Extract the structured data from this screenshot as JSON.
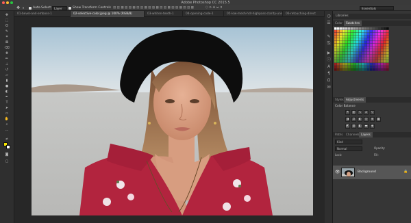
{
  "app": {
    "title": "Adobe Photoshop CC 2015.5",
    "workspace": "Essentials"
  },
  "options_bar": {
    "auto_select_label": "Auto-Select:",
    "auto_select_value": "Layer",
    "show_transform_label": "Show Transform Controls"
  },
  "tabs": [
    {
      "label": "01-bevel-and-emboss-1"
    },
    {
      "label": "02-selective-color.jpeg @ 100% (RGB/8)"
    },
    {
      "label": "03-whiten-teeth-1"
    },
    {
      "label": "04-opening-code-1"
    },
    {
      "label": "05-low-mesh-hdr-highpass-clarity-unsharp-1"
    },
    {
      "label": "06-retouching-direct"
    }
  ],
  "panels": {
    "libraries": {
      "title": "Libraries"
    },
    "color_tabs": [
      "Color",
      "Swatches"
    ],
    "adjust_tabs": [
      "Styles",
      "Adjustments"
    ],
    "adjust_hint": "Color Balance",
    "layer_tabs": [
      "Paths",
      "Channels",
      "Layers"
    ],
    "kind_label": "Kind",
    "blend_mode": "Normal",
    "opacity_label": "Opacity:",
    "lock_label": "Lock:",
    "fill_label": "Fill:",
    "layers": [
      {
        "name": "Background"
      }
    ]
  },
  "colors": {
    "accent": "#2d8ceb",
    "foreground": "#f5e400",
    "background": "#ffffff"
  },
  "icons": {
    "close": "close-dot",
    "minimize": "minimize-dot",
    "zoom": "zoom-dot",
    "eye": "eye-icon",
    "lock": "lock-icon"
  }
}
